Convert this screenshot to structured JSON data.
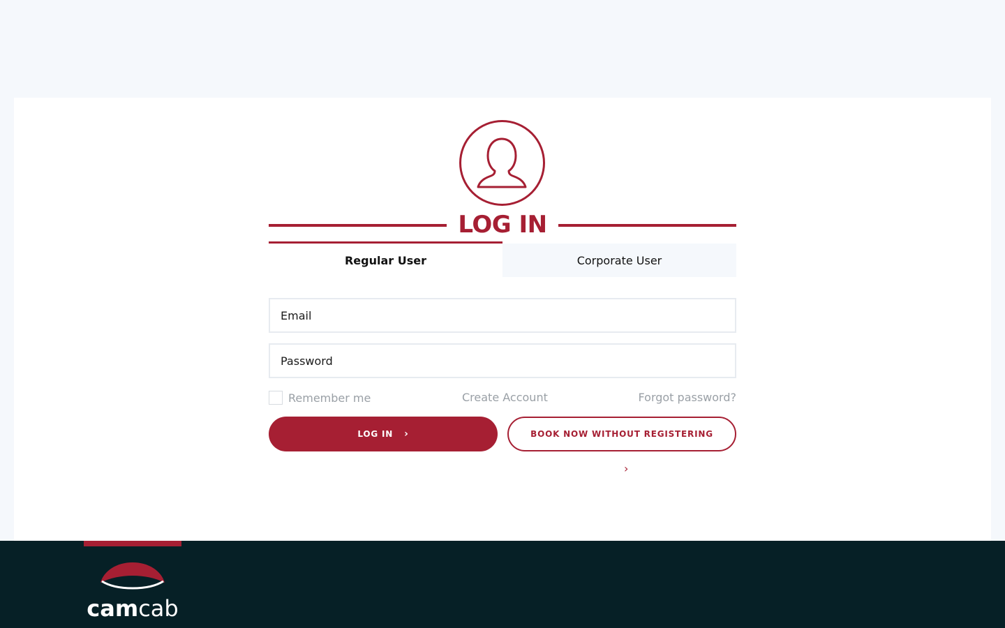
{
  "title": "LOG IN",
  "tabs": [
    {
      "label": "Regular User",
      "active": true
    },
    {
      "label": "Corporate User",
      "active": false
    }
  ],
  "form": {
    "email_placeholder": "Email",
    "password_placeholder": "Password",
    "remember_label": "Remember me",
    "create_account": "Create Account",
    "forgot_password": "Forgot password?"
  },
  "buttons": {
    "login": "LOG IN",
    "book": "BOOK NOW WITHOUT REGISTERING"
  },
  "footer": {
    "brand_part1": "cam",
    "brand_part2": "cab"
  },
  "colors": {
    "accent": "#a61f33",
    "footer_bg": "#062026",
    "page_bg": "#f5f8fc"
  },
  "icons": [
    "user-avatar-icon",
    "chevron-right-icon"
  ]
}
